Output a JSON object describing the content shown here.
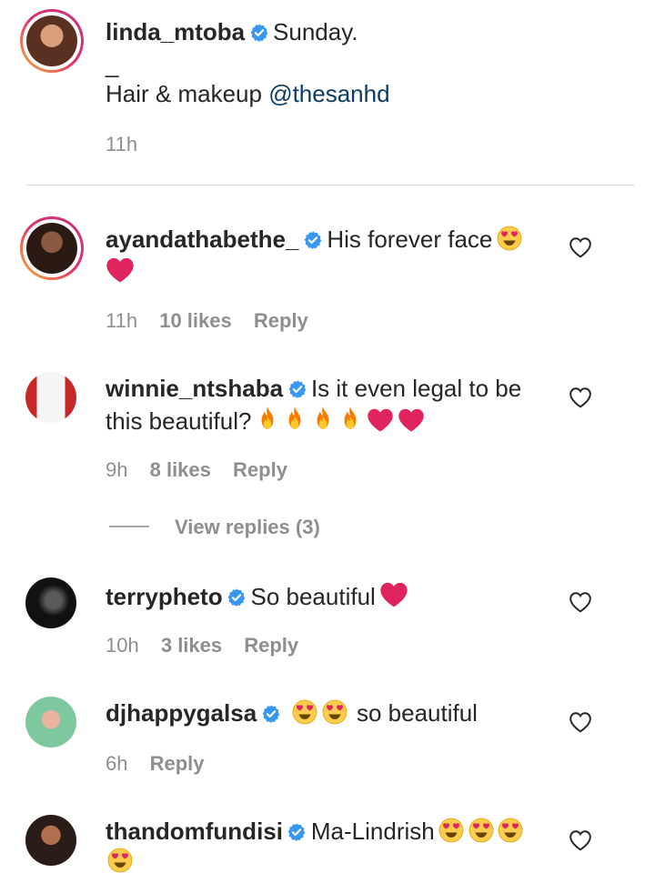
{
  "caption": {
    "username": "linda_mtoba",
    "line1": "Sunday.",
    "line2": "_",
    "line3_prefix": "Hair & makeup ",
    "line3_mention": "@thesanhd",
    "time": "11h"
  },
  "comments": [
    {
      "username": "ayandathabethe_",
      "text": "His forever face",
      "time": "11h",
      "likes": "10 likes",
      "reply": "Reply"
    },
    {
      "username": "winnie_ntshaba",
      "text1": "Is it even legal to be",
      "text2": "this beautiful?",
      "time": "9h",
      "likes": "8 likes",
      "reply": "Reply",
      "view_replies": "View replies (3)"
    },
    {
      "username": "terrypheto",
      "text": "So beautiful",
      "time": "10h",
      "likes": "3 likes",
      "reply": "Reply"
    },
    {
      "username": "djhappygalsa",
      "text": "so beautiful",
      "time": "6h",
      "reply": "Reply"
    },
    {
      "username": "thandomfundisi",
      "text": "Ma-Lindrish"
    }
  ],
  "colors": {
    "verified": "#3897f0",
    "heart_red": "#e0245e",
    "meta_gray": "#8e8e8e"
  }
}
